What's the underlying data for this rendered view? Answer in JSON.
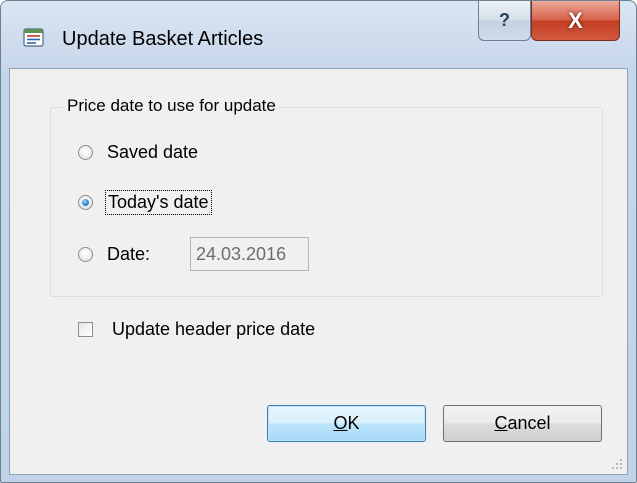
{
  "window": {
    "title": "Update Basket Articles",
    "help_label": "?",
    "close_label": "X"
  },
  "price_group": {
    "legend": "Price date to use for update",
    "options": [
      {
        "label": "Saved date",
        "checked": false
      },
      {
        "label": "Today's date",
        "checked": true
      },
      {
        "label": "Date:",
        "checked": false
      }
    ],
    "date_value": "24.03.2016"
  },
  "header_checkbox": {
    "label": "Update header price date",
    "checked": false
  },
  "buttons": {
    "ok_mnemonic": "O",
    "ok_rest": "K",
    "cancel_mnemonic": "C",
    "cancel_rest": "ancel"
  }
}
